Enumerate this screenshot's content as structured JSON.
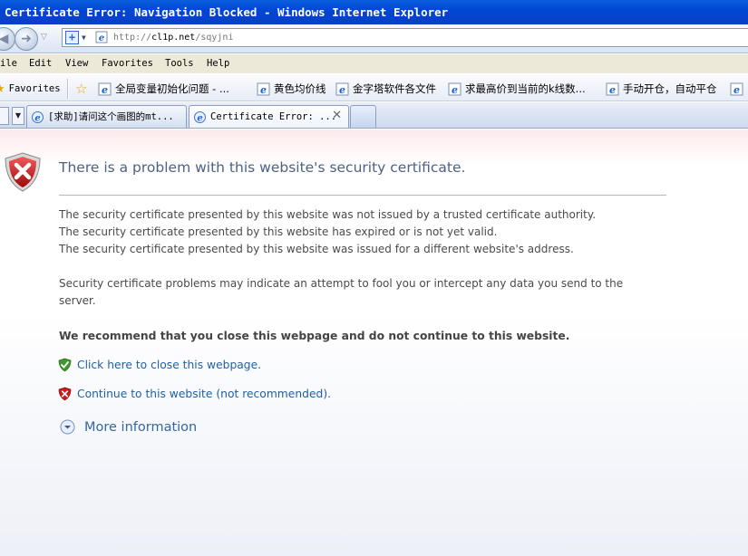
{
  "window": {
    "title": "Certificate Error: Navigation Blocked - Windows Internet Explorer"
  },
  "address_bar": {
    "url_prefix": "http://",
    "url_host": "cl1p.net",
    "url_path": "/sqyjni"
  },
  "menu": [
    "ile",
    "Edit",
    "View",
    "Favorites",
    "Tools",
    "Help"
  ],
  "favorites_bar": {
    "favorites_label": "Favorites",
    "links": [
      "全局变量初始化问题 - ...",
      "黄色均价线",
      "金字塔软件各文件",
      "求最高价到当前的k线数...",
      "手动开仓，自动平仓"
    ]
  },
  "tabs": [
    {
      "title": "[求助]请问这个画图的mt...",
      "active": false
    },
    {
      "title": "Certificate Error: ...",
      "active": true
    }
  ],
  "content": {
    "title": "There is a problem with this website's security certificate.",
    "reasons": [
      "The security certificate presented by this website was not issued by a trusted certificate authority.",
      "The security certificate presented by this website has expired or is not yet valid.",
      "The security certificate presented by this website was issued for a different website's address."
    ],
    "warning": "Security certificate problems may indicate an attempt to fool you or intercept any data you send to the server.",
    "recommendation": "We recommend that you close this webpage and do not continue to this website.",
    "close_link": "Click here to close this webpage.",
    "continue_link": "Continue to this website (not recommended).",
    "more_info": "More information"
  },
  "colors": {
    "title_bar": "#0046d5",
    "link": "#23609e",
    "heading": "#4d6185"
  }
}
